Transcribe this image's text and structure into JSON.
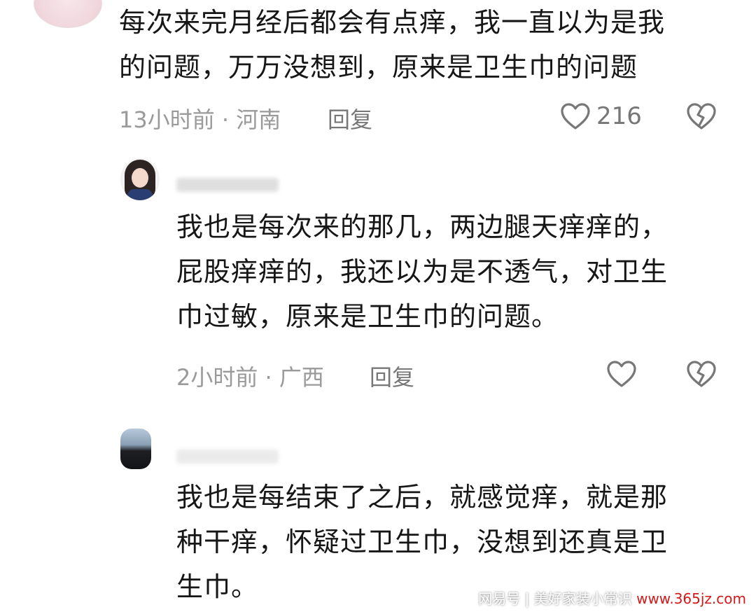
{
  "comments": [
    {
      "text": "每次来完月经后都会有点痒，我一直以为是我\n的问题，万万没想到，原来是卫生巾的问题",
      "meta": "13小时前 · 河南",
      "reply_label": "回复",
      "like_count": "216"
    },
    {
      "text": "我也是每次来的那几，两边腿天痒痒的，\n屁股痒痒的，我还以为是不透气，对卫生\n巾过敏，原来是卫生巾的问题。",
      "meta": "2小时前 · 广西",
      "reply_label": "回复"
    },
    {
      "text": "我也是每结束了之后，就感觉痒，就是那\n种干痒，怀疑过卫生巾，没想到还真是卫\n生巾。"
    }
  ],
  "icons": {
    "like": "heart-outline-icon",
    "dislike": "broken-heart-icon"
  },
  "watermark": {
    "text": "网易号 | 美好家装小常识",
    "site": "www.365jz.com"
  },
  "colors": {
    "text": "#161616",
    "meta": "#9a9a9a",
    "icon": "#777777"
  }
}
